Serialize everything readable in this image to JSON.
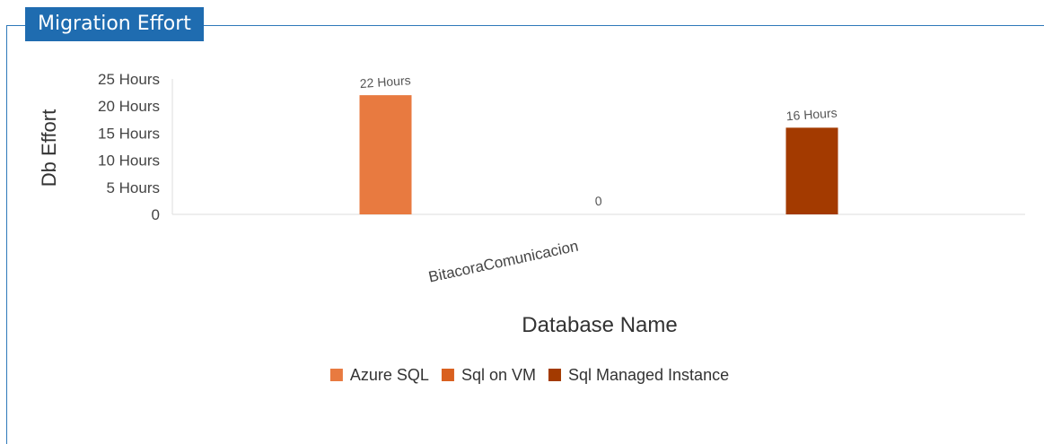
{
  "panel": {
    "title": "Migration Effort"
  },
  "chart_data": {
    "type": "bar",
    "categories": [
      "BitacoraComunicacion"
    ],
    "series": [
      {
        "name": "Azure SQL",
        "values": [
          22
        ],
        "color": "#e87a40",
        "label": "22 Hours"
      },
      {
        "name": "Sql on VM",
        "values": [
          0
        ],
        "color": "#d9601f",
        "label": "0"
      },
      {
        "name": "Sql Managed Instance",
        "values": [
          16
        ],
        "color": "#a33a00",
        "label": "16 Hours"
      }
    ],
    "yticks": [
      "0",
      "5 Hours",
      "10 Hours",
      "15 Hours",
      "20 Hours",
      "25 Hours"
    ],
    "ytick_values": [
      0,
      5,
      10,
      15,
      20,
      25
    ],
    "ylim": [
      0,
      25
    ],
    "xlabel": "Database Name",
    "ylabel": "Db Effort",
    "legend_position": "bottom",
    "grid": false
  }
}
